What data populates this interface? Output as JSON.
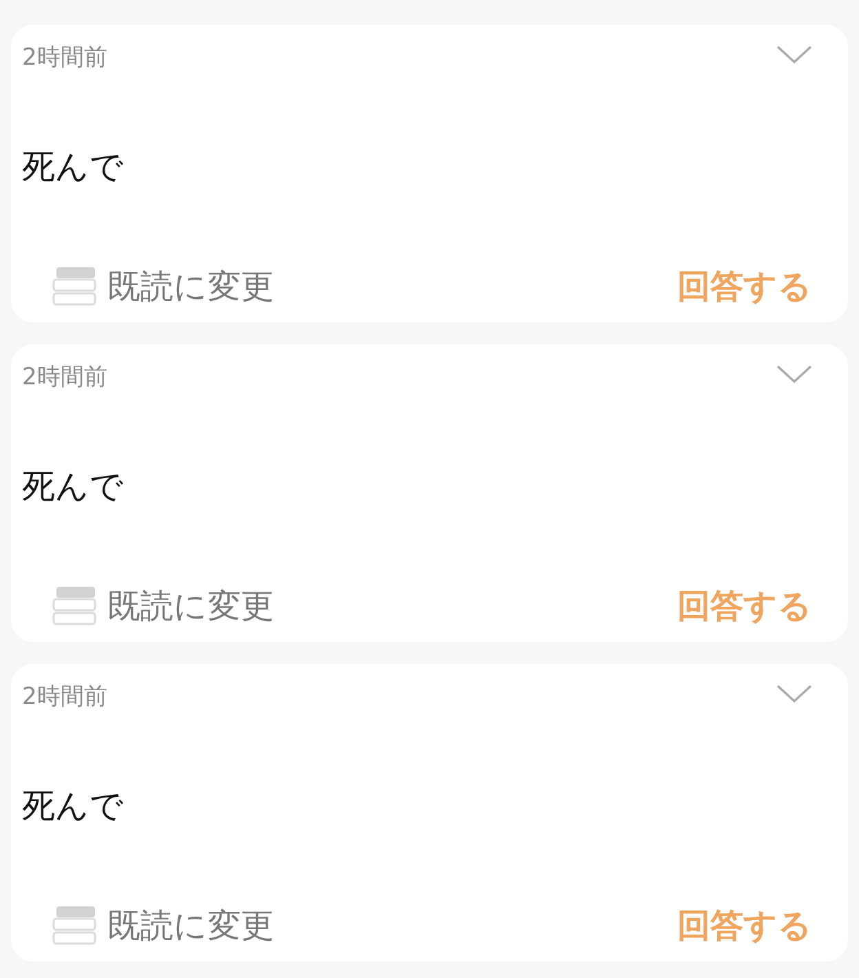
{
  "messages": [
    {
      "time": "2時間前",
      "body": "死んで",
      "mark_read": "既読に変更",
      "reply": "回答する"
    },
    {
      "time": "2時間前",
      "body": "死んで",
      "mark_read": "既読に変更",
      "reply": "回答する"
    },
    {
      "time": "2時間前",
      "body": "死んで",
      "mark_read": "既読に変更",
      "reply": "回答する"
    }
  ]
}
